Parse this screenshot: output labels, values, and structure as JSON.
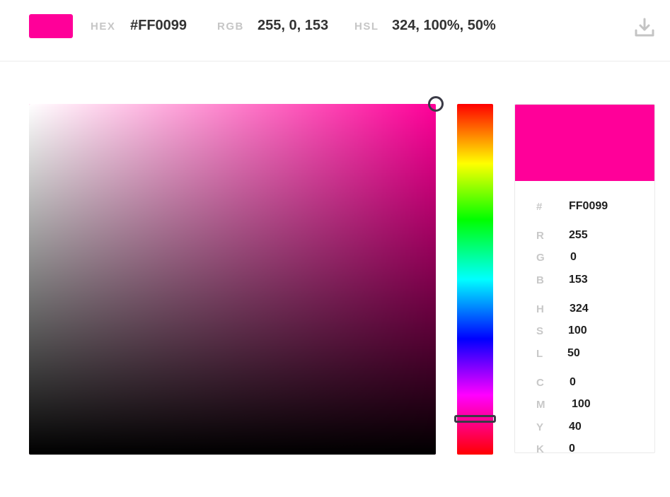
{
  "color": {
    "hex_color": "#FF0099",
    "hue_color": "#FF0099"
  },
  "header": {
    "hex_label": "HEX",
    "hex_value": "#FF0099",
    "rgb_label": "RGB",
    "rgb_value": "255, 0, 153",
    "hsl_label": "HSL",
    "hsl_value": "324, 100%, 50%",
    "download_icon": "download-icon"
  },
  "picker": {
    "saturation": 1.0,
    "value": 1.0,
    "hue_degrees": 324
  },
  "panel": {
    "hex": {
      "label": "#",
      "value": "FF0099"
    },
    "r": {
      "label": "R",
      "value": "255"
    },
    "g": {
      "label": "G",
      "value": "0"
    },
    "b": {
      "label": "B",
      "value": "153"
    },
    "h": {
      "label": "H",
      "value": "324"
    },
    "s": {
      "label": "S",
      "value": "100"
    },
    "l": {
      "label": "L",
      "value": "50"
    },
    "c": {
      "label": "C",
      "value": "0"
    },
    "m": {
      "label": "M",
      "value": "100"
    },
    "y": {
      "label": "Y",
      "value": "40"
    },
    "k": {
      "label": "K",
      "value": "0"
    }
  }
}
